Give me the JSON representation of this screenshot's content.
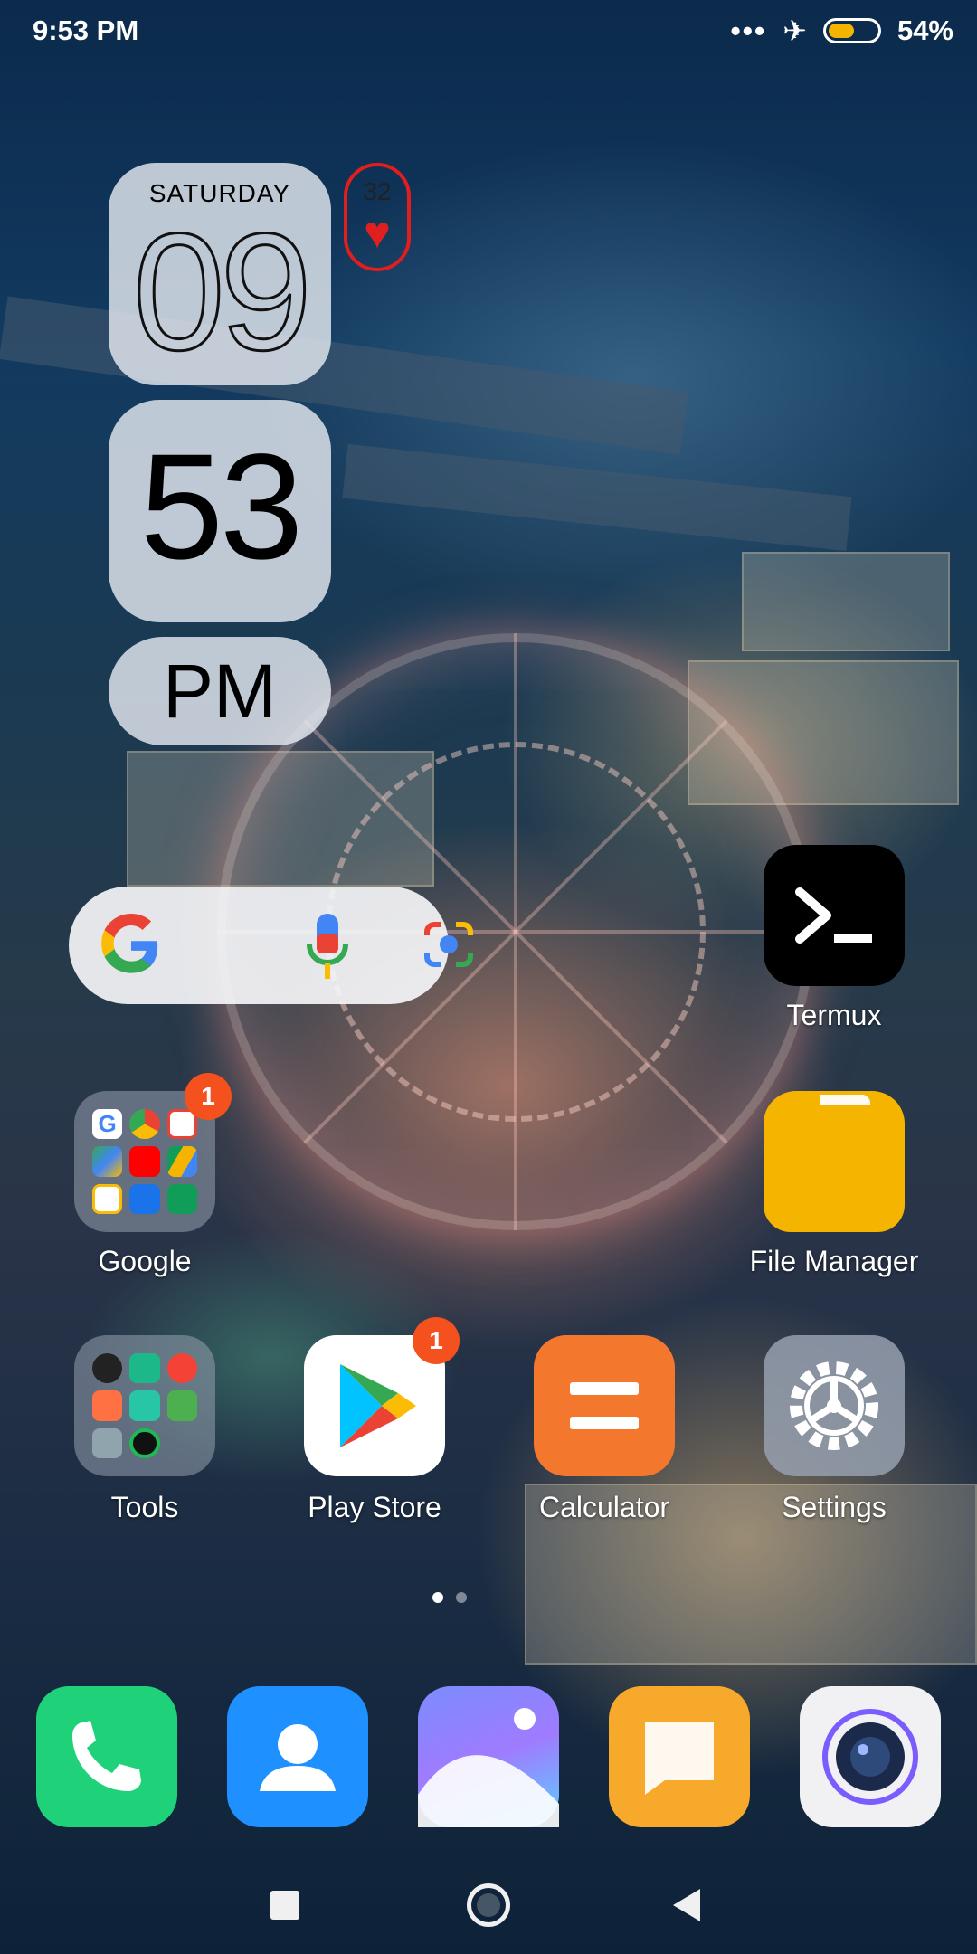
{
  "status_bar": {
    "time": "9:53 PM",
    "more_icon": "three-dots-icon",
    "airplane_icon": "airplane-icon",
    "battery_level": 0.54,
    "battery_text": "54%"
  },
  "clock_widget": {
    "day": "SATURDAY",
    "hour": "09",
    "minute": "53",
    "ampm": "PM",
    "heart_count": "32",
    "heart_icon": "heart-icon"
  },
  "search_widget": {
    "google_icon": "google-g-icon",
    "mic_icon": "mic-icon",
    "lens_icon": "lens-camera-icon"
  },
  "apps": {
    "termux": {
      "label": "Termux",
      "icon": "terminal-icon"
    },
    "file_manager": {
      "label": "File Manager",
      "icon": "folder-icon"
    },
    "google_folder": {
      "label": "Google",
      "badge": "1"
    },
    "tools_folder": {
      "label": "Tools"
    },
    "play_store": {
      "label": "Play Store",
      "badge": "1",
      "icon": "play-store-icon"
    },
    "calculator": {
      "label": "Calculator",
      "icon": "calculator-icon"
    },
    "settings": {
      "label": "Settings",
      "icon": "gear-icon"
    }
  },
  "page_indicator": {
    "pages": 2,
    "current": 1
  },
  "dock": {
    "phone": "phone-icon",
    "contacts": "contacts-icon",
    "gallery": "gallery-icon",
    "messages": "messages-icon",
    "camera": "camera-icon"
  },
  "nav_bar": {
    "recents": "recents-square-icon",
    "home": "home-circle-icon",
    "back": "back-triangle-icon"
  },
  "colors": {
    "badge": "#f4511e",
    "heart": "#e0201f",
    "battery_fill": "#f4b400",
    "file_manager": "#f4b400",
    "calculator": "#f4772e"
  }
}
